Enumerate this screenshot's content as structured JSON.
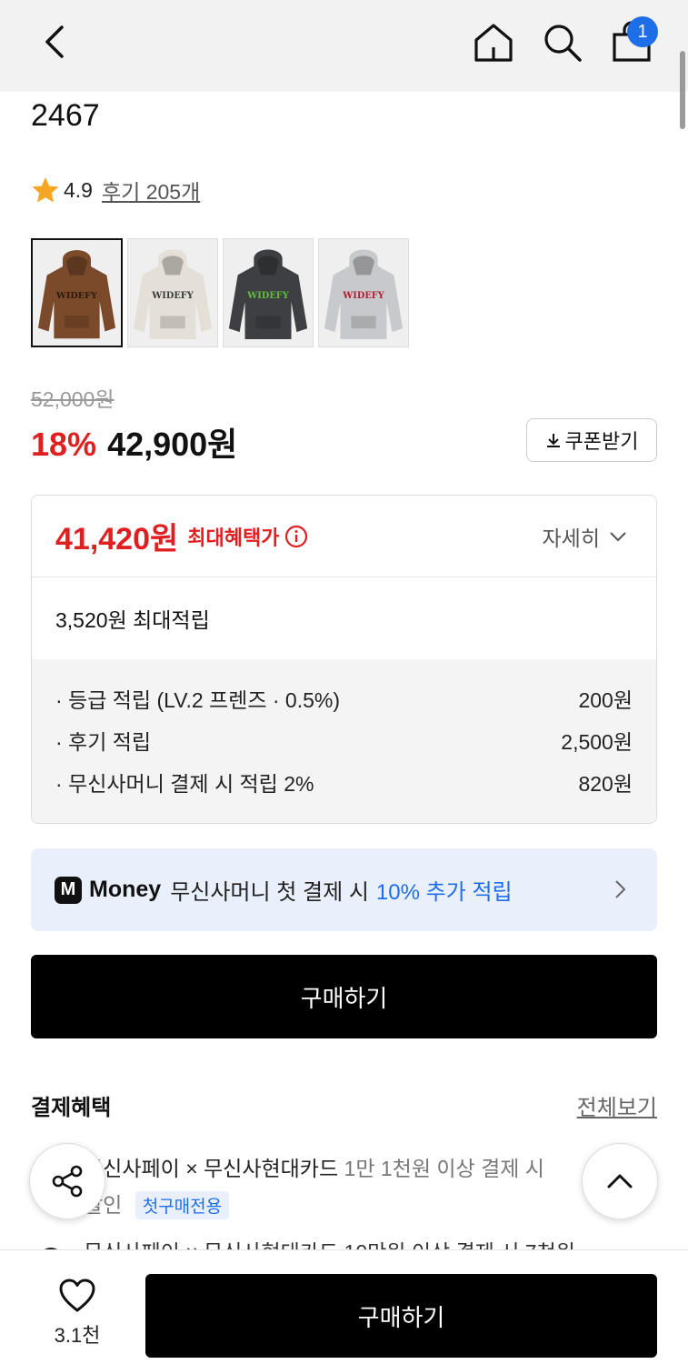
{
  "header": {
    "cart_count": "1",
    "icons": [
      "chevron-left-icon",
      "home-icon",
      "search-icon",
      "shopping-bag-icon"
    ]
  },
  "product": {
    "title": "2467",
    "rating": "4.9",
    "reviews_label": "후기 205개",
    "thumbnails": [
      {
        "color": "#7a4a2a",
        "label": "WIDEFY",
        "text_color": "#2a1a10"
      },
      {
        "color": "#e4e0d8",
        "label": "WIDEFY",
        "text_color": "#3a3a3a"
      },
      {
        "color": "#3e3f42",
        "label": "WIDEFY",
        "text_color": "#5fbf3a"
      },
      {
        "color": "#c8c9cc",
        "label": "WIDEFY",
        "text_color": "#b02030"
      }
    ],
    "original_price": "52,000원",
    "discount": "18%",
    "price": "42,900원",
    "coupon_label": "쿠폰받기"
  },
  "benefits": {
    "max_price": "41,420원",
    "max_label": "최대혜택가",
    "detail_label": "자세히",
    "max_points": "3,520원 최대적립",
    "items": [
      {
        "label": "· 등급 적립 (LV.2 프렌즈 · 0.5%)",
        "value": "200원"
      },
      {
        "label": "· 후기 적립",
        "value": "2,500원"
      },
      {
        "label": "· 무신사머니 결제 시 적립 2%",
        "value": "820원"
      }
    ]
  },
  "money_banner": {
    "logo": "M",
    "brand": "Money",
    "text": "무신사머니 첫 결제 시",
    "highlight": "10% 추가 적립"
  },
  "buy_label": "구매하기",
  "payment": {
    "title": "결제혜택",
    "view_all": "전체보기",
    "item1_card": "무신사페이 × 무신사현대카드",
    "item1_cond": "1만 1천원 이상 결제 시",
    "item1_line2": "할인",
    "item1_tag": "첫구매전용",
    "item2": "무신사페이 × 무신사현대카드 10만원 이상 결제 시 7천원"
  },
  "bottom": {
    "likes": "3.1천",
    "buy_label": "구매하기"
  },
  "colors": {
    "accent_red": "#e02020",
    "accent_blue": "#1e6ee8",
    "black": "#000000"
  }
}
